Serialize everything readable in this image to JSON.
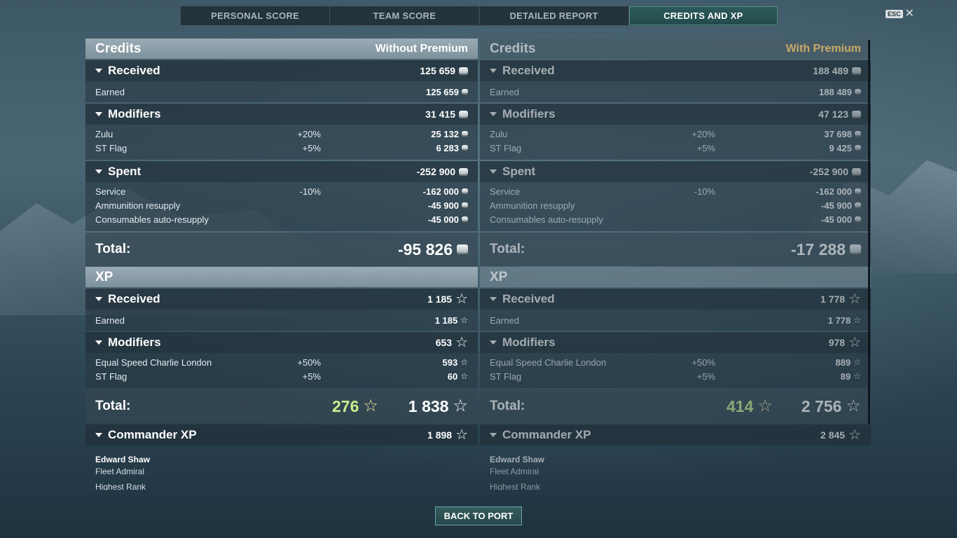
{
  "tabs": [
    {
      "label": "PERSONAL SCORE",
      "active": false
    },
    {
      "label": "TEAM SCORE",
      "active": false
    },
    {
      "label": "DETAILED REPORT",
      "active": false
    },
    {
      "label": "CREDITS AND XP",
      "active": true
    }
  ],
  "esc": {
    "key": "ESC",
    "close": "✕"
  },
  "without_premium": {
    "credits_title": "Credits",
    "mode_label": "Without Premium",
    "received": {
      "label": "Received",
      "value": "125 659",
      "rows": [
        {
          "name": "Earned",
          "value": "125 659"
        }
      ]
    },
    "modifiers": {
      "label": "Modifiers",
      "value": "31 415",
      "rows": [
        {
          "name": "Zulu",
          "pct": "+20%",
          "value": "25 132"
        },
        {
          "name": "ST Flag",
          "pct": "+5%",
          "value": "6 283"
        }
      ]
    },
    "spent": {
      "label": "Spent",
      "value": "-252 900",
      "rows": [
        {
          "name": "Service",
          "pct": "-10%",
          "value": "-162 000"
        },
        {
          "name": "Ammunition resupply",
          "pct": "",
          "value": "-45 900"
        },
        {
          "name": "Consumables auto-resupply",
          "pct": "",
          "value": "-45 000"
        }
      ]
    },
    "credits_total": {
      "label": "Total:",
      "value": "-95 826"
    },
    "xp_title": "XP",
    "xp_received": {
      "label": "Received",
      "value": "1 185",
      "rows": [
        {
          "name": "Earned",
          "value": "1 185"
        }
      ]
    },
    "xp_modifiers": {
      "label": "Modifiers",
      "value": "653",
      "rows": [
        {
          "name": "Equal Speed Charlie London",
          "pct": "+50%",
          "value": "593"
        },
        {
          "name": "ST Flag",
          "pct": "+5%",
          "value": "60"
        }
      ]
    },
    "xp_total": {
      "label": "Total:",
      "free_xp": "276",
      "value": "1 838"
    },
    "commander": {
      "label": "Commander XP",
      "value": "1 898",
      "name": "Edward Shaw",
      "rank": "Fleet Admiral",
      "extra": "Highest Rank"
    }
  },
  "with_premium": {
    "credits_title": "Credits",
    "mode_label": "With Premium",
    "received": {
      "label": "Received",
      "value": "188 489",
      "rows": [
        {
          "name": "Earned",
          "value": "188 489"
        }
      ]
    },
    "modifiers": {
      "label": "Modifiers",
      "value": "47 123",
      "rows": [
        {
          "name": "Zulu",
          "pct": "+20%",
          "value": "37 698"
        },
        {
          "name": "ST Flag",
          "pct": "+5%",
          "value": "9 425"
        }
      ]
    },
    "spent": {
      "label": "Spent",
      "value": "-252 900",
      "rows": [
        {
          "name": "Service",
          "pct": "-10%",
          "value": "-162 000"
        },
        {
          "name": "Ammunition resupply",
          "pct": "",
          "value": "-45 900"
        },
        {
          "name": "Consumables auto-resupply",
          "pct": "",
          "value": "-45 000"
        }
      ]
    },
    "credits_total": {
      "label": "Total:",
      "value": "-17 288"
    },
    "xp_title": "XP",
    "xp_received": {
      "label": "Received",
      "value": "1 778",
      "rows": [
        {
          "name": "Earned",
          "value": "1 778"
        }
      ]
    },
    "xp_modifiers": {
      "label": "Modifiers",
      "value": "978",
      "rows": [
        {
          "name": "Equal Speed Charlie London",
          "pct": "+50%",
          "value": "889"
        },
        {
          "name": "ST Flag",
          "pct": "+5%",
          "value": "89"
        }
      ]
    },
    "xp_total": {
      "label": "Total:",
      "free_xp": "414",
      "value": "2 756"
    },
    "commander": {
      "label": "Commander XP",
      "value": "2 845",
      "name": "Edward Shaw",
      "rank": "Fleet Admiral",
      "extra": "Highest Rank"
    }
  },
  "back_button": "BACK TO PORT",
  "icons": {
    "credits": "credits-coin-icon",
    "xp": "xp-star-icon",
    "free_xp": "free-xp-star-icon",
    "close": "close-icon"
  },
  "colors": {
    "active_tab": "#2d5a5a",
    "free_xp": "#c4f08e",
    "premium_gold": "#e1b766"
  }
}
